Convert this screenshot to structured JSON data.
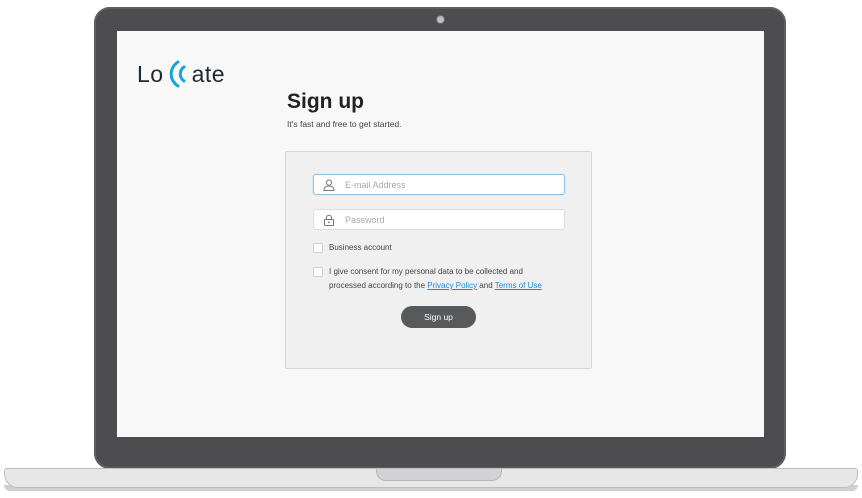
{
  "brand": {
    "logo_prefix": "Lo",
    "logo_suffix": "ate"
  },
  "page": {
    "title": "Sign up",
    "subtitle": "It's fast and free to get started."
  },
  "form": {
    "email_placeholder": "E-mail Address",
    "password_placeholder": "Password",
    "business_label": "Business account",
    "consent_text_1": "I give consent for my personal data to be collected and",
    "consent_text_2": "processed according to the ",
    "privacy_link": "Privacy Policy",
    "consent_and": " and ",
    "terms_link": "Terms of Use",
    "submit_label": "Sign up"
  },
  "icons": {
    "email": "user-icon",
    "password": "lock-icon",
    "logo": "signal-wave-icon"
  },
  "colors": {
    "accent": "#1a8cd8",
    "button": "#58595b",
    "logo_wave": "#1aa3d9"
  }
}
